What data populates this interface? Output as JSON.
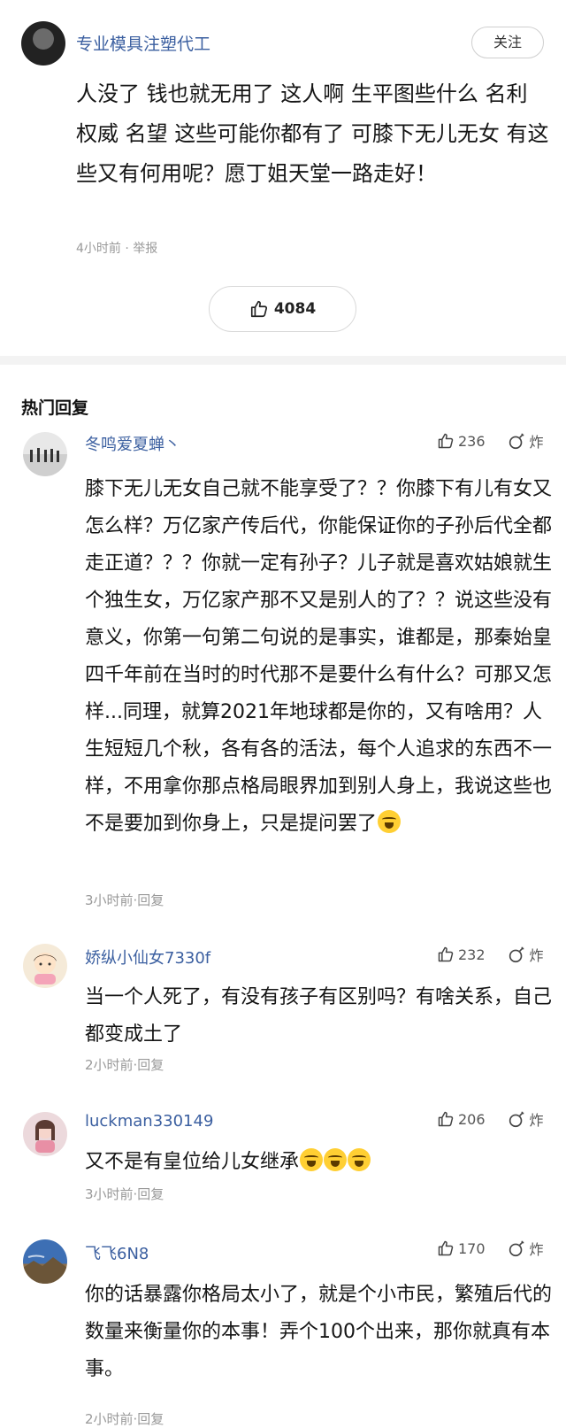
{
  "main_comment": {
    "username": "专业模具注塑代工",
    "follow_label": "关注",
    "text": "人没了  钱也就无用了  这人啊  生平图些什么  名利  权威  名望  这些可能你都有了  可膝下无儿无女  有这些又有何用呢？愿丁姐天堂一路走好！",
    "time": "4小时前",
    "report_label": "举报",
    "likes": "4084"
  },
  "section_title": "热门回复",
  "replies": [
    {
      "username": "冬鸣爱夏蝉丶",
      "likes": "236",
      "bomb_label": "炸",
      "text": "膝下无儿无女自己就不能享受了？？你膝下有儿有女又怎么样？万亿家产传后代，你能保证你的子孙后代全都走正道？？？你就一定有孙子？儿子就是喜欢姑娘就生个独生女，万亿家产那不又是别人的了？？说这些没有意义，你第一句第二句说的是事实，谁都是，那秦始皇四千年前在当时的时代那不是要什么有什么？可那又怎样...同理，就算2021年地球都是你的，又有啥用？人生短短几个秋，各有各的活法，每个人追求的东西不一样，不用拿你那点格局眼界加到别人身上，我说这些也不是要加到你身上，只是提问罢了",
      "meta": "3小时前·回复"
    },
    {
      "username": "娇纵小仙女7330f",
      "likes": "232",
      "bomb_label": "炸",
      "text": "当一个人死了，有没有孩子有区别吗？有啥关系，自己都变成土了",
      "meta": "2小时前·回复"
    },
    {
      "username": "luckman330149",
      "likes": "206",
      "bomb_label": "炸",
      "text": "又不是有皇位给儿女继承",
      "meta": "3小时前·回复"
    },
    {
      "username": "飞飞6N8",
      "likes": "170",
      "bomb_label": "炸",
      "text": "你的话暴露你格局太小了，就是个小市民，繁殖后代的数量来衡量你的本事！弄个100个出来，那你就真有本事。",
      "meta": "2小时前·回复"
    }
  ]
}
